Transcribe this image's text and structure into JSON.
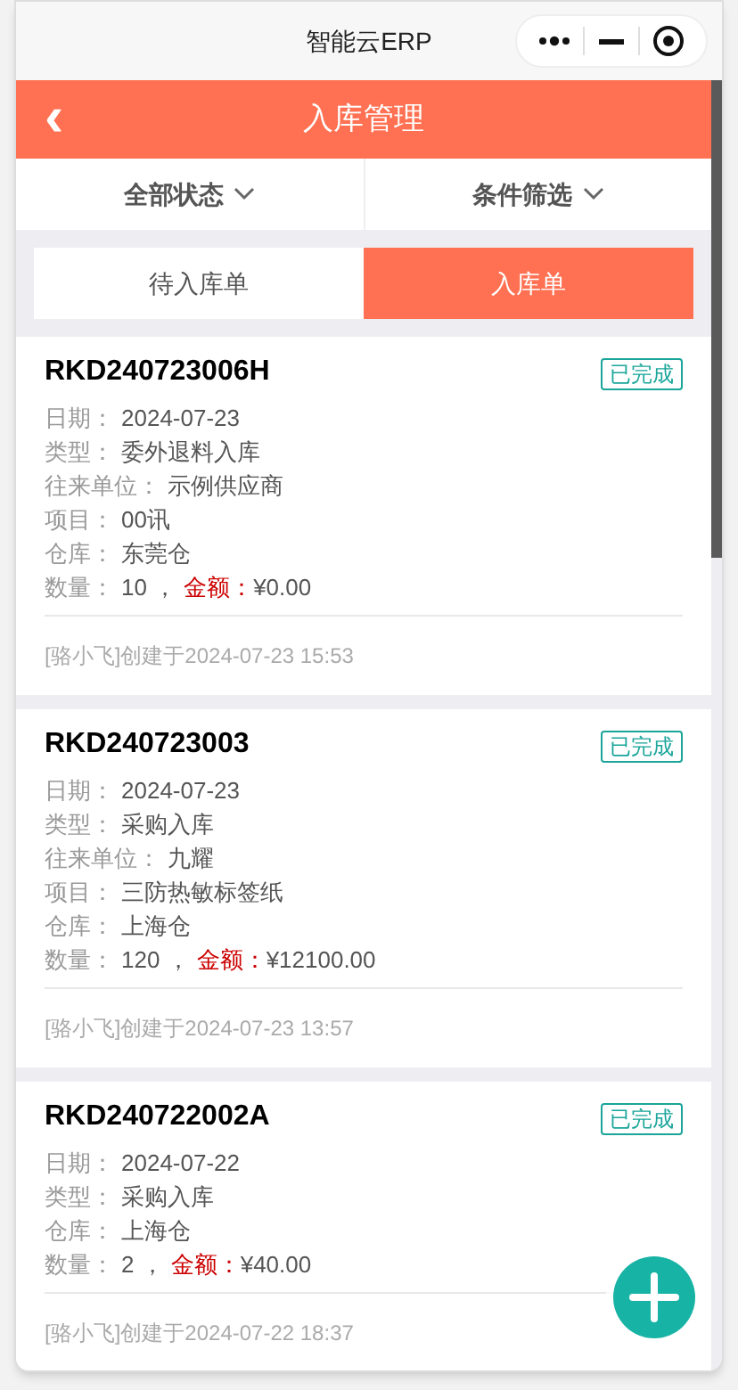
{
  "window": {
    "title": "智能云ERP"
  },
  "header": {
    "back": "‹",
    "title": "入库管理"
  },
  "filters": [
    {
      "label": "全部状态"
    },
    {
      "label": "条件筛选"
    }
  ],
  "tabs": [
    {
      "label": "待入库单",
      "selected": false
    },
    {
      "label": "入库单",
      "selected": true
    }
  ],
  "orders": [
    {
      "number": "RKD240723006H",
      "status": "已完成",
      "fields": [
        {
          "label": "日期：",
          "value": "2024-07-23"
        },
        {
          "label": "类型：",
          "value": "委外退料入库"
        },
        {
          "label": "往来单位：",
          "value": "示例供应商"
        },
        {
          "label": "项目：",
          "value": "00讯"
        },
        {
          "label": "仓库：",
          "value": "东莞仓"
        }
      ],
      "quantity_label": "数量：",
      "quantity": "10 ，",
      "amount_label": "金额：",
      "amount": "¥0.00",
      "created": "[骆小飞]创建于2024-07-23 15:53"
    },
    {
      "number": "RKD240723003",
      "status": "已完成",
      "fields": [
        {
          "label": "日期：",
          "value": "2024-07-23"
        },
        {
          "label": "类型：",
          "value": "采购入库"
        },
        {
          "label": "往来单位：",
          "value": "九耀"
        },
        {
          "label": "项目：",
          "value": "三防热敏标签纸"
        },
        {
          "label": "仓库：",
          "value": "上海仓"
        }
      ],
      "quantity_label": "数量：",
      "quantity": "120 ，",
      "amount_label": "金额：",
      "amount": "¥12100.00",
      "created": "[骆小飞]创建于2024-07-23 13:57"
    },
    {
      "number": "RKD240722002A",
      "status": "已完成",
      "fields": [
        {
          "label": "日期：",
          "value": "2024-07-22"
        },
        {
          "label": "类型：",
          "value": "采购入库"
        },
        {
          "label": "仓库：",
          "value": "上海仓"
        }
      ],
      "quantity_label": "数量：",
      "quantity": "2 ，",
      "amount_label": "金额：",
      "amount": "¥40.00",
      "created": "[骆小飞]创建于2024-07-22 18:37"
    }
  ]
}
